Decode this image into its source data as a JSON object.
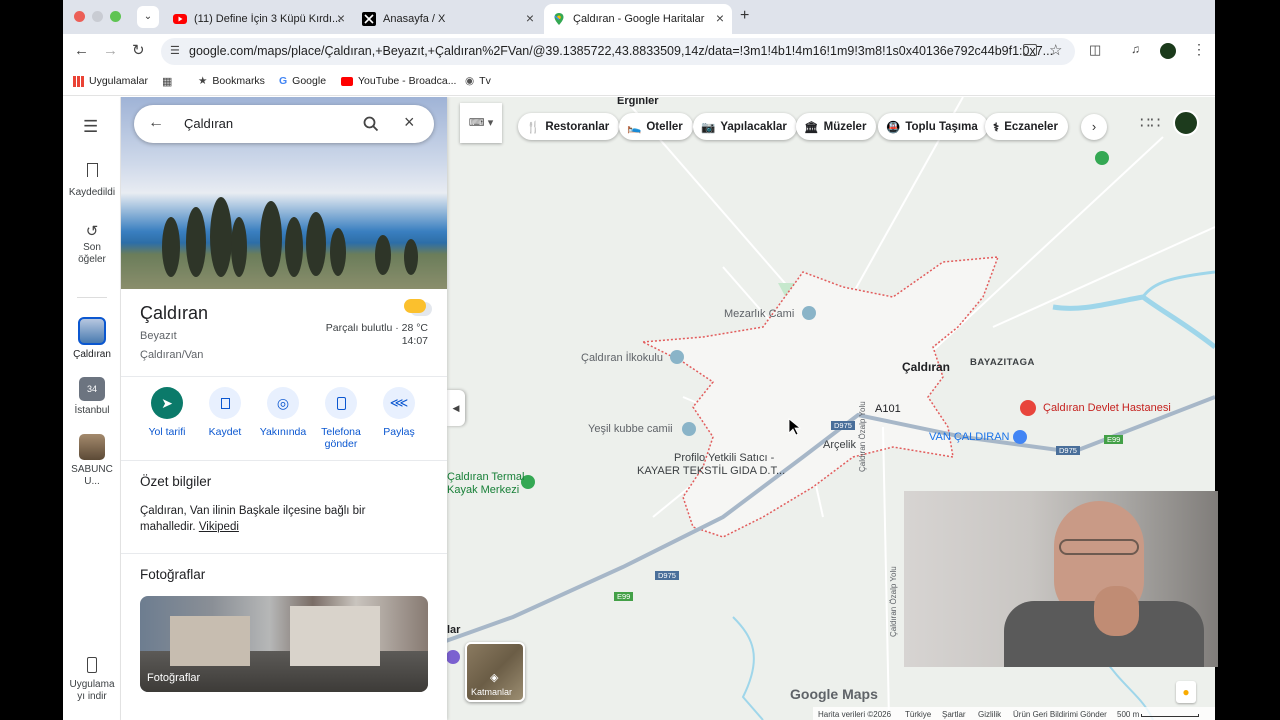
{
  "tabs": [
    {
      "title": "(11) Define İçin 3 Küpü Kırdı..."
    },
    {
      "title": "Anasayfa / X"
    },
    {
      "title": "Çaldıran - Google Haritalar"
    }
  ],
  "address_bar": {
    "url": "google.com/maps/place/Çaldıran,+Beyazıt,+Çaldıran%2FVan/@39.1385722,43.8833509,14z/data=!3m1!4b1!4m16!1m9!3m8!1s0x40136e792c44b9f1:0x7..."
  },
  "bookmarks": [
    "Uygulamalar",
    "Bookmarks",
    "Google",
    "YouTube - Broadca...",
    "Tv"
  ],
  "rail": {
    "menu": "",
    "saved": "Kaydedildi",
    "recents": "Son öğeler",
    "caldiran": "Çaldıran",
    "istanbul": "İstanbul",
    "istanbul_badge": "34",
    "sabunc": "SABUNC U...",
    "app": "Uygulama yı indir"
  },
  "search": {
    "value": "Çaldıran"
  },
  "place": {
    "name": "Çaldıran",
    "sub1": "Beyazıt",
    "sub2": "Çaldıran/Van",
    "weather": "Parçalı bulutlu · 28 °C",
    "time": "14:07"
  },
  "actions": [
    "Yol tarifi",
    "Kaydet",
    "Yakınında",
    "Telefona gönder",
    "Paylaş"
  ],
  "summary": {
    "heading": "Özet bilgiler",
    "text": "Çaldıran, Van ilinin Başkale ilçesine bağlı bir mahalledir.",
    "link": "Vikipedi"
  },
  "photos": {
    "heading": "Fotoğraflar",
    "overlay": "Fotoğraflar"
  },
  "chips": [
    "Restoranlar",
    "Oteller",
    "Yapılacaklar",
    "Müzeler",
    "Toplu Taşıma",
    "Eczaneler"
  ],
  "map_labels": {
    "erginler": "Erginler",
    "mezarlik": "Mezarlık Cami",
    "ilkokulu": "Çaldıran İlkokulu",
    "caldiran": "Çaldıran",
    "bayazitaga": "BAYAZITAGA",
    "hastane": "Çaldıran Devlet Hastanesi",
    "a101": "A101",
    "vancaldiran": "VAN ÇALDIRAN",
    "arcelik": "Arçelik",
    "yesil": "Yeşil kubbe camii",
    "profilo": "Profilo Yetkili Satıcı -",
    "kayaer": "KAYAER TEKSTİL GIDA D.T...",
    "termal1": "Çaldıran Termal",
    "termal2": "Kayak Merkezi",
    "ozalp1": "Çaldıran Özalp Yolu",
    "ozalp2": "Çaldıran Özalp Yolu",
    "lar": "lar",
    "d975a": "D975",
    "d975b": "D975",
    "d975c": "D975",
    "e99a": "E99",
    "e99b": "E99"
  },
  "layers": "Katmanlar",
  "logo": "Google Maps",
  "footer": [
    "Harita verileri ©2026",
    "Türkiye",
    "Şartlar",
    "Gizlilik",
    "Ürün Geri Bildirimi Gönder",
    "500 m"
  ]
}
